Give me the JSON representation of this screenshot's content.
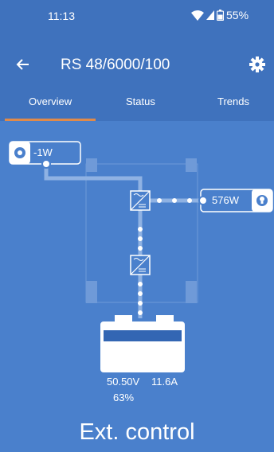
{
  "status_bar": {
    "time": "11:13",
    "battery": "55%",
    "icons": [
      "wifi-icon",
      "signal-icon",
      "battery-icon"
    ]
  },
  "app_bar": {
    "title": "RS 48/6000/100",
    "back_icon": "arrow-left-icon",
    "settings_icon": "gear-icon"
  },
  "tabs": [
    {
      "label": "Overview",
      "active": true
    },
    {
      "label": "Status",
      "active": false
    },
    {
      "label": "Trends",
      "active": false
    }
  ],
  "diagram": {
    "input": {
      "value": "-1W",
      "icon": "solar-input-icon"
    },
    "output": {
      "value": "576W",
      "icon": "bulb-icon"
    },
    "converters": [
      "converter-icon-upper",
      "converter-icon-lower"
    ],
    "battery": {
      "voltage": "50.50V",
      "current": "11.6A",
      "soc": "63%",
      "soc_level": 0.63
    }
  },
  "footer": {
    "mode_text": "Ext. control"
  },
  "colors": {
    "background": "#4a80cc",
    "app_bar": "#3f72bd",
    "tab_indicator": "#e08a4a",
    "text": "#ffffff"
  }
}
